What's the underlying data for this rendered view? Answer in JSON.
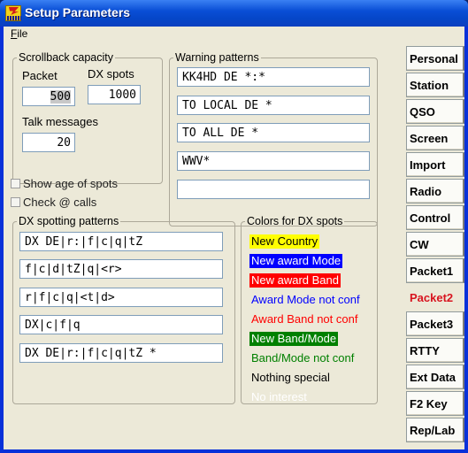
{
  "window": {
    "title": "Setup Parameters"
  },
  "menu": {
    "file_underline": "F",
    "file_rest": "ile"
  },
  "scrollback": {
    "legend": "Scrollback capacity",
    "packet_label": "Packet",
    "packet_value": "500",
    "dx_label": "DX spots",
    "dx_value": "1000",
    "talk_label": "Talk messages",
    "talk_value": "20"
  },
  "options": {
    "show_age": "Show age of spots",
    "check_calls": "Check @ calls"
  },
  "warning": {
    "legend": "Warning patterns",
    "patterns": [
      "KK4HD DE *:*",
      "TO LOCAL DE *",
      "TO ALL DE *",
      "WWV*",
      ""
    ]
  },
  "dxspot": {
    "legend": "DX spotting patterns",
    "patterns": [
      "DX DE|r:|f|c|q|tZ",
      "f|c|d|tZ|q|<r>",
      "r|f|c|q|<t|d>",
      "DX|c|f|q",
      "DX DE|r:|f|c|q|tZ *"
    ]
  },
  "colors": {
    "legend": "Colors for DX spots",
    "items": [
      {
        "label": "New Country",
        "fg": "#000000",
        "bg": "#ffff00"
      },
      {
        "label": "New award Mode",
        "fg": "#ffffff",
        "bg": "#0000ff"
      },
      {
        "label": "New award Band",
        "fg": "#ffffff",
        "bg": "#ff0000"
      },
      {
        "label": "Award Mode not conf",
        "fg": "#0000ff",
        "bg": ""
      },
      {
        "label": "Award Band not conf",
        "fg": "#ff0000",
        "bg": ""
      },
      {
        "label": "New Band/Mode",
        "fg": "#ffffff",
        "bg": "#008000"
      },
      {
        "label": "Band/Mode not conf",
        "fg": "#008000",
        "bg": ""
      },
      {
        "label": "Nothing special",
        "fg": "#000000",
        "bg": ""
      },
      {
        "label": "No interest",
        "fg": "#ffffff",
        "bg": ""
      }
    ]
  },
  "tabs": [
    {
      "label": "Personal"
    },
    {
      "label": "Station"
    },
    {
      "label": "QSO"
    },
    {
      "label": "Screen"
    },
    {
      "label": "Import"
    },
    {
      "label": "Radio"
    },
    {
      "label": "Control"
    },
    {
      "label": "CW"
    },
    {
      "label": "Packet1"
    },
    {
      "label": "Packet2",
      "active": true
    },
    {
      "label": "Packet3"
    },
    {
      "label": "RTTY"
    },
    {
      "label": "Ext Data"
    },
    {
      "label": "F2 Key"
    },
    {
      "label": "Rep/Lab"
    }
  ]
}
